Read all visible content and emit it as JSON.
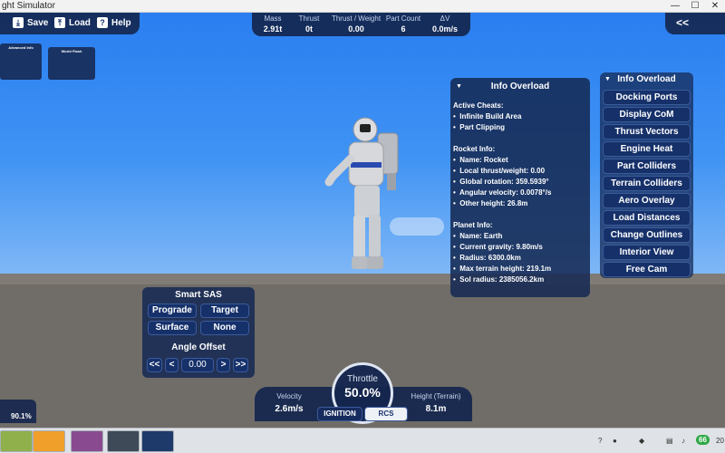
{
  "window": {
    "title": "ght Simulator"
  },
  "toolbar": {
    "save_label": "Save",
    "load_label": "Load",
    "help_label": "Help",
    "collapse_label": "<<"
  },
  "stats": [
    {
      "label": "Mass",
      "value": "2.91t"
    },
    {
      "label": "Thrust",
      "value": "0t"
    },
    {
      "label": "Thrust / Weight",
      "value": "0.00"
    },
    {
      "label": "Part Count",
      "value": "6"
    },
    {
      "label": "ΔV",
      "value": "0.0m/s"
    }
  ],
  "mini_panels": {
    "advanced": "Advanced Info",
    "world": "World Flash"
  },
  "info_panel": {
    "title": "Info Overload",
    "active_cheats_header": "Active Cheats:",
    "active_cheats": [
      "Infinite Build Area",
      "Part Clipping"
    ],
    "rocket_header": "Rocket Info:",
    "rocket": [
      "Name: Rocket",
      "Local thrust/weight: 0.00",
      "Global rotation: 359.5939°",
      "Angular velocity: 0.0078°/s",
      "Other height: 26.8m"
    ],
    "planet_header": "Planet Info:",
    "planet": [
      "Name: Earth",
      "Current gravity: 9.80m/s",
      "Radius: 6300.0km",
      "Max terrain height: 219.1m",
      "Sol radius: 2385056.2km"
    ]
  },
  "menu": {
    "title": "Info Overload",
    "items": [
      "Docking Ports",
      "Display CoM",
      "Thrust Vectors",
      "Engine Heat",
      "Part Colliders",
      "Terrain Colliders",
      "Aero Overlay",
      "Load Distances",
      "Change Outlines",
      "Interior View",
      "Free Cam"
    ]
  },
  "sas": {
    "title": "Smart SAS",
    "buttons": [
      "Prograde",
      "Target",
      "Surface",
      "None"
    ],
    "offset_title": "Angle Offset",
    "offset_value": "0.00",
    "left_fast": "<<",
    "left": "<",
    "right": ">",
    "right_fast": ">>"
  },
  "hud": {
    "velocity_label": "Velocity",
    "velocity_value": "2.6m/s",
    "throttle_label": "Throttle",
    "throttle_value": "50.0%",
    "height_label": "Height (Terrain)",
    "height_value": "8.1m",
    "ignition_label": "IGNITION",
    "rcs_label": "RCS",
    "throttle_fraction": 0.5
  },
  "bottom_left": {
    "value": "90.1%"
  },
  "taskbar": {
    "tray_badge": "66",
    "clock_partial": "20"
  }
}
